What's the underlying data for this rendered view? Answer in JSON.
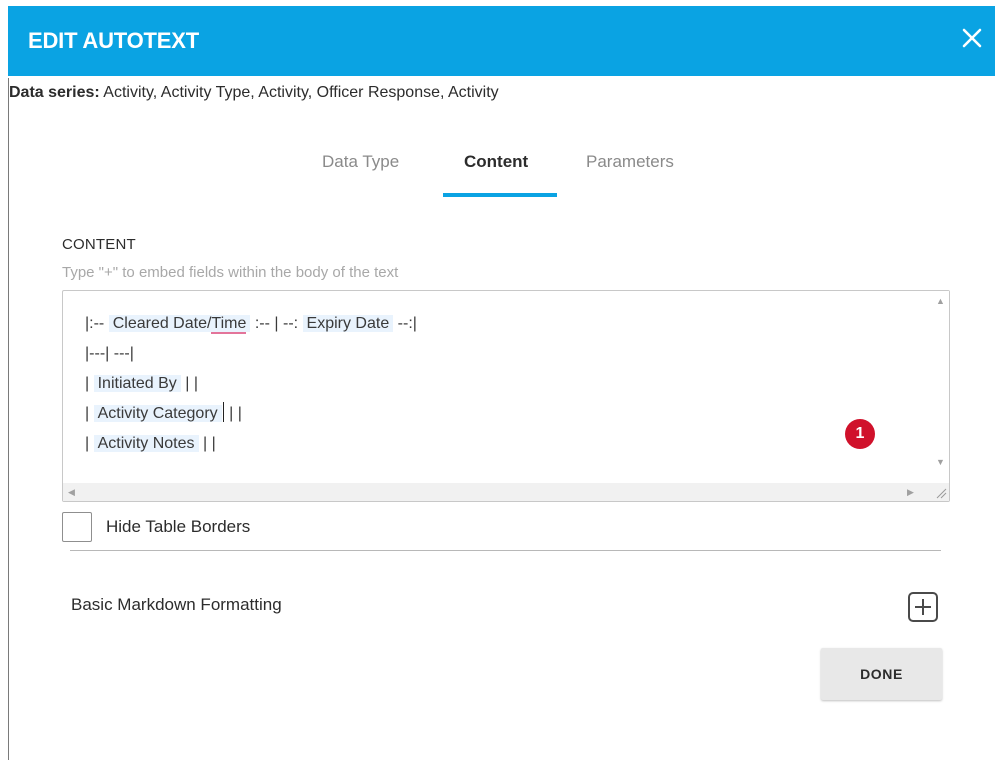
{
  "header": {
    "title": "EDIT AUTOTEXT",
    "close_icon": "close-icon"
  },
  "data_series": {
    "label": "Data series:",
    "value": "Activity, Activity Type, Activity, Officer Response, Activity"
  },
  "tabs": [
    {
      "label": "Data Type",
      "active": false
    },
    {
      "label": "Content",
      "active": true
    },
    {
      "label": "Parameters",
      "active": false
    }
  ],
  "content": {
    "label": "CONTENT",
    "hint": "Type \"+\" to embed fields within the body of the text",
    "lines": [
      {
        "pre": "|:-- ",
        "field": "Cleared Date/",
        "field_underlined": "Time",
        "mid": " :-- | --: ",
        "field2": "Expiry Date",
        "post": " --:|"
      },
      {
        "pre": "|---| ---|"
      },
      {
        "pre": "| ",
        "field": "Initiated By",
        "post": " | |"
      },
      {
        "pre": "| ",
        "field": "Activity Category",
        "post": " | |"
      },
      {
        "pre": "| ",
        "field": "Activity Notes",
        "post": " | |"
      }
    ],
    "badge": "1"
  },
  "hide_borders": {
    "label": "Hide Table Borders",
    "checked": false
  },
  "markdown": {
    "label": "Basic Markdown Formatting",
    "expand_icon": "plus-square-icon"
  },
  "actions": {
    "done_label": "DONE"
  },
  "colors": {
    "header_bg": "#0aa3e3",
    "tab_accent": "#0aa3e3",
    "badge": "#d0112b",
    "field_highlight": "#e9f3fd"
  }
}
